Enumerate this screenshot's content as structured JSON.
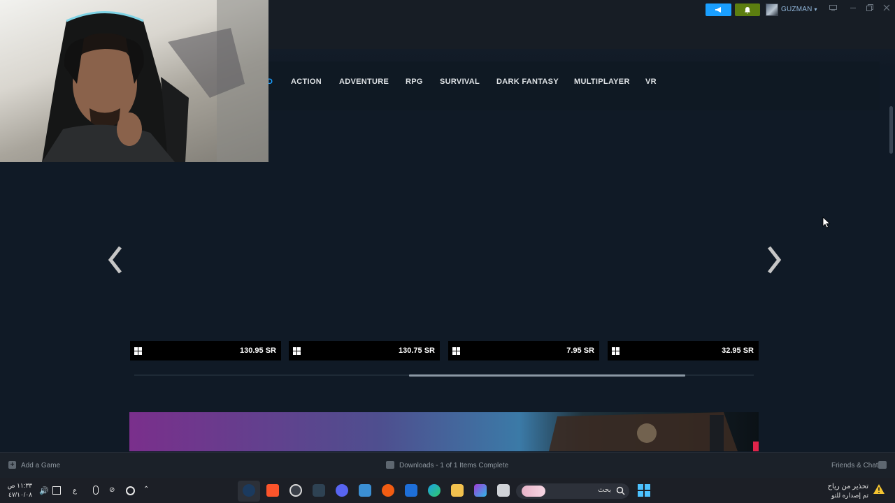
{
  "user": {
    "name": "GUZMAN"
  },
  "categories": [
    {
      "label": "ACTION"
    },
    {
      "label": "ADVENTURE"
    },
    {
      "label": "RPG"
    },
    {
      "label": "SURVIVAL"
    },
    {
      "label": "DARK FANTASY"
    },
    {
      "label": "MULTIPLAYER"
    },
    {
      "label": "VR"
    }
  ],
  "carousel": {
    "prices": [
      "130.95 SR",
      "130.75 SR",
      "7.95 SR",
      "32.95 SR"
    ]
  },
  "bottom_bar": {
    "add_game": "Add a Game",
    "downloads": "Downloads - 1 of 1 Items Complete",
    "friends_chat": "Friends & Chat"
  },
  "taskbar": {
    "search_placeholder": "بحث",
    "time": "١١:٣٣ ص",
    "date": "٤٧/١٠/٠٨",
    "lang": "ع",
    "notification_title": "تحذير من رياح",
    "notification_subtitle": "تم إصداره للتو"
  },
  "colors": {
    "accent": "#1a9fff",
    "notify": "#5c7e10",
    "background": "#101a26"
  }
}
